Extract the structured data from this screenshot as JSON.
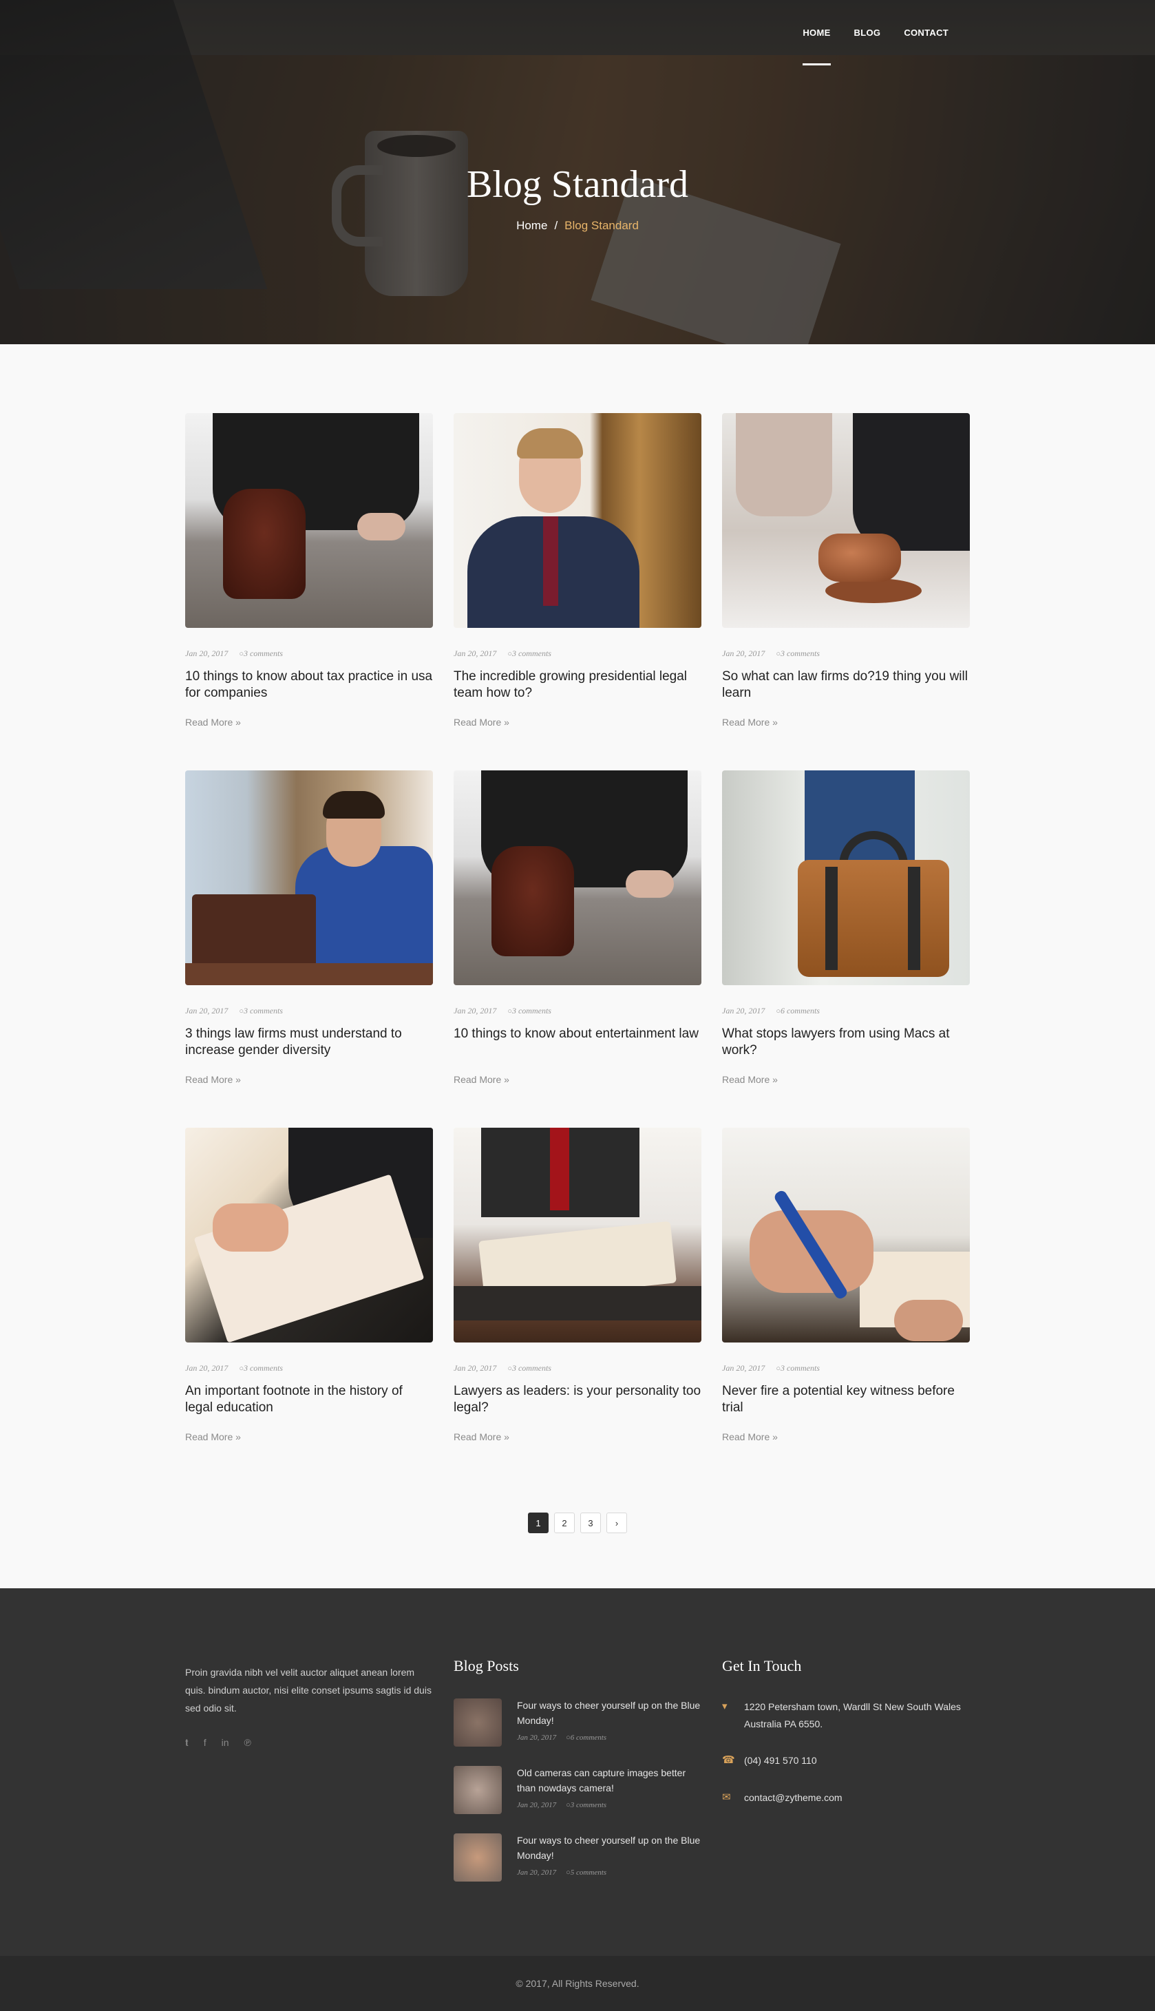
{
  "nav": {
    "home": "HOME",
    "blog": "BLOG",
    "contact": "CONTACT"
  },
  "hero": {
    "title": "Blog Standard",
    "crumb_home": "Home",
    "crumb_sep": "/",
    "crumb_current": "Blog Standard"
  },
  "posts": [
    {
      "date": "Jan 20, 2017",
      "comments": "3 comments",
      "title": "10 things to know about tax practice in usa for companies",
      "more": "Read More"
    },
    {
      "date": "Jan 20, 2017",
      "comments": "3 comments",
      "title": "The incredible growing presidential legal team how to?",
      "more": "Read More"
    },
    {
      "date": "Jan 20, 2017",
      "comments": "3 comments",
      "title": "So what can law firms do?19 thing you will learn",
      "more": "Read More"
    },
    {
      "date": "Jan 20, 2017",
      "comments": "3 comments",
      "title": "3 things law firms must understand to increase gender diversity",
      "more": "Read More"
    },
    {
      "date": "Jan 20, 2017",
      "comments": "3 comments",
      "title": "10 things to know about entertainment law",
      "more": "Read More"
    },
    {
      "date": "Jan 20, 2017",
      "comments": "6 comments",
      "title": "What stops lawyers from using Macs at work?",
      "more": "Read More"
    },
    {
      "date": "Jan 20, 2017",
      "comments": "3 comments",
      "title": "An important footnote in the history of legal education",
      "more": "Read More"
    },
    {
      "date": "Jan 20, 2017",
      "comments": "3 comments",
      "title": "Lawyers as leaders: is your personality too legal?",
      "more": "Read More"
    },
    {
      "date": "Jan 20, 2017",
      "comments": "3 comments",
      "title": "Never fire a potential key witness before trial",
      "more": "Read More"
    }
  ],
  "pagination": {
    "p1": "1",
    "p2": "2",
    "p3": "3",
    "next": "›"
  },
  "footer": {
    "about": "Proin gravida nibh vel velit auctor aliquet anean lorem quis. bindum auctor, nisi elite conset ipsums sagtis id duis sed odio sit.",
    "social_icons": [
      "twitter-icon",
      "facebook-icon",
      "linkedin-icon",
      "pinterest-icon"
    ],
    "blog_title": "Blog Posts",
    "blog_posts": [
      {
        "title": "Four ways to cheer yourself up on the Blue Monday!",
        "date": "Jan 20, 2017",
        "comments": "6 comments"
      },
      {
        "title": "Old cameras can capture images better than nowdays camera!",
        "date": "Jan 20, 2017",
        "comments": "3 comments"
      },
      {
        "title": "Four ways to cheer yourself up on the Blue Monday!",
        "date": "Jan 20, 2017",
        "comments": "5 comments"
      }
    ],
    "contact_title": "Get In Touch",
    "address": "1220 Petersham town, Wardll St New South Wales Australia PA 6550.",
    "phone": "(04) 491 570 110",
    "email": "contact@zytheme.com",
    "copyright": "© 2017, All Rights Reserved."
  },
  "colors": {
    "accent": "#e8b56a",
    "footer_bg": "#333333",
    "copy_bg": "#2a2a2a"
  }
}
